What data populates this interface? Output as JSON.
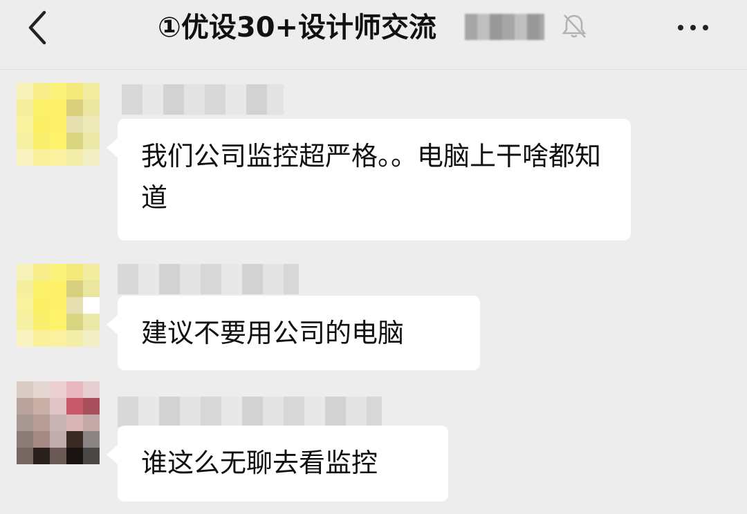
{
  "header": {
    "title": "①优设30+设计师交流"
  },
  "messages": [
    {
      "text": "我们公司监控超严格。。电脑上干啥都知道"
    },
    {
      "text": "建议不要用公司的电脑"
    },
    {
      "text": "谁这么无聊去看监控"
    }
  ],
  "icons": {
    "back": "chevron-left-icon",
    "mute": "bell-muted-icon",
    "more": "more-horizontal-icon"
  }
}
